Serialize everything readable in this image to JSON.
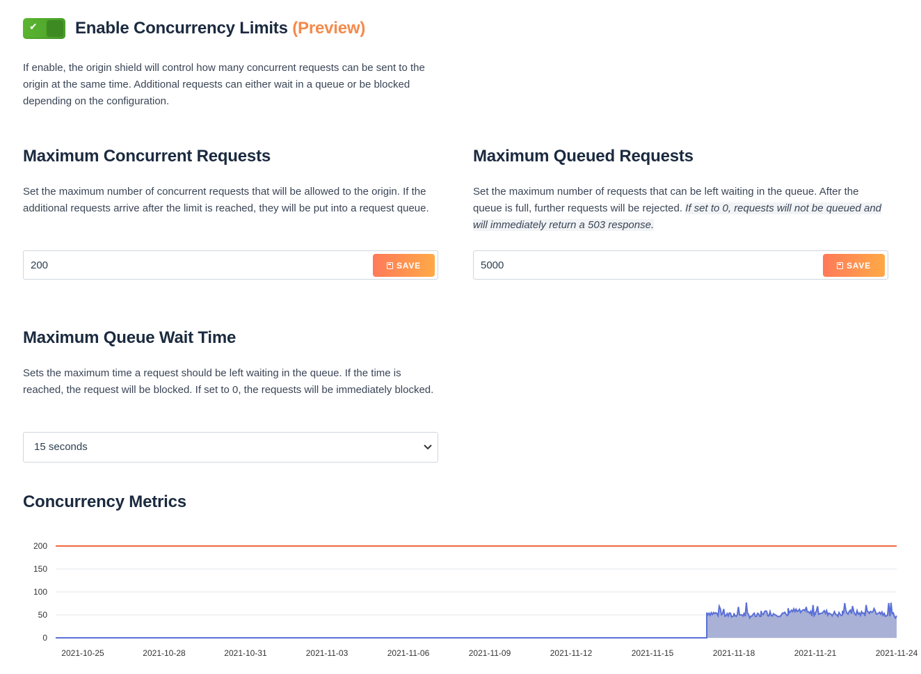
{
  "header": {
    "toggle_on": true,
    "title": "Enable Concurrency Limits",
    "preview_label": "(Preview)",
    "intro": "If enable, the origin shield will control how many concurrent requests can be sent to the origin at the same time. Additional requests can either wait in a queue or be blocked depending on the configuration."
  },
  "max_concurrent": {
    "title": "Maximum Concurrent Requests",
    "description": "Set the maximum number of concurrent requests that will be allowed to the origin. If the additional requests arrive after the limit is reached, they will be put into a request queue.",
    "value": "200",
    "save_label": "SAVE"
  },
  "max_queued": {
    "title": "Maximum Queued Requests",
    "description": "Set the maximum number of requests that can be left waiting in the queue. After the queue is full, further requests will be rejected. ",
    "note": "If set to 0, requests will not be queued and will immediately return a 503 response.",
    "value": "5000",
    "save_label": "SAVE"
  },
  "queue_wait": {
    "title": "Maximum Queue Wait Time",
    "description": "Sets the maximum time a request should be left waiting in the queue. If the time is reached, the request will be blocked. If set to 0, the requests will be immediately blocked.",
    "selected": "15 seconds"
  },
  "metrics": {
    "title": "Concurrency Metrics"
  },
  "colors": {
    "limit_line": "#f0693e",
    "series_line": "#5a6fd6",
    "series_fill": "#a9b1d6",
    "save_start": "#ff7a59",
    "save_end": "#ffa947",
    "toggle_green": "#5cb531",
    "preview_orange": "#f58a4b"
  },
  "chart_data": {
    "type": "area",
    "y_ticks": [
      "0",
      "50",
      "100",
      "150",
      "200"
    ],
    "ylim": [
      0,
      200
    ],
    "x_ticks": [
      "2021-10-25",
      "2021-10-28",
      "2021-10-31",
      "2021-11-03",
      "2021-11-06",
      "2021-11-09",
      "2021-11-12",
      "2021-11-15",
      "2021-11-18",
      "2021-11-21",
      "2021-11-24"
    ],
    "xlim": [
      "2021-10-24",
      "2021-11-24"
    ],
    "limit": 200,
    "series": [
      {
        "x": [
          "2021-10-24",
          "2021-11-17",
          "2021-11-17",
          "2021-11-18",
          "2021-11-18",
          "2021-11-19",
          "2021-11-19",
          "2021-11-20",
          "2021-11-20",
          "2021-11-21",
          "2021-11-21",
          "2021-11-22",
          "2021-11-22",
          "2021-11-23",
          "2021-11-23",
          "2021-11-24"
        ],
        "values": [
          0,
          0,
          55,
          48,
          52,
          47,
          55,
          50,
          60,
          52,
          58,
          50,
          56,
          52,
          60,
          48
        ]
      }
    ],
    "grid": true
  }
}
